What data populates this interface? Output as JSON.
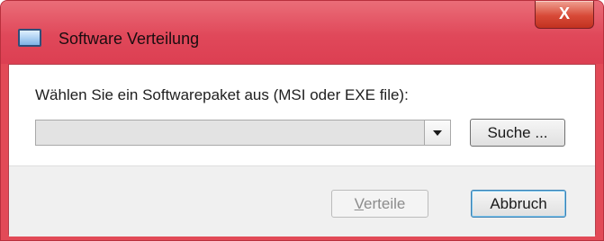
{
  "window": {
    "title": "Software Verteilung",
    "close_label": "X"
  },
  "dialog": {
    "prompt": "Wählen Sie ein Softwarepaket aus (MSI oder EXE file):",
    "package_select": {
      "value": ""
    },
    "search_label": "Suche ...",
    "distribute_mnemonic": "V",
    "distribute_rest": "erteile",
    "cancel_label": "Abbruch"
  },
  "colors": {
    "titlebar": "#e24a57",
    "close_button": "#c8392a",
    "default_button_border": "#3c7fb1"
  }
}
